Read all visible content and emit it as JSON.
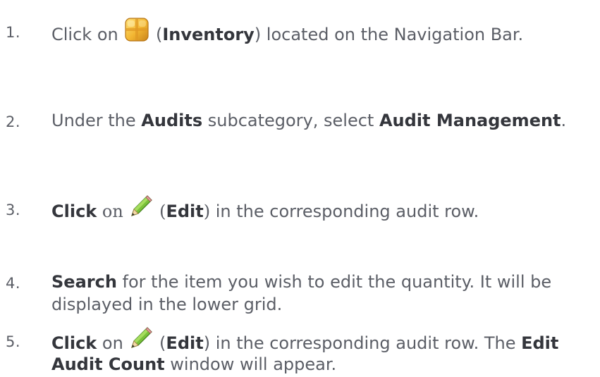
{
  "steps": [
    {
      "number": "1.",
      "pre": "Click on ",
      "icon": "inventory-box-icon",
      "open_paren": " (",
      "bold1": "Inventory",
      "post": ") located on the Navigation Bar."
    },
    {
      "number": "2.",
      "pre": "Under the ",
      "bold1": "Audits",
      "mid": " subcategory, select ",
      "bold2": "Audit Management",
      "post": "."
    },
    {
      "number": "3.",
      "bold1": "Click",
      "serif_on": " on ",
      "icon": "pencil-edit-icon",
      "serif_open": " (",
      "bold2": "Edit",
      "serif_close": ")",
      "post": " in the corresponding audit row."
    },
    {
      "number": "4.",
      "bold1": "Search",
      "line1_post": " for the item you wish to edit the quantity.  It will be",
      "line2": "displayed in the lower grid."
    },
    {
      "number": "5.",
      "bold1": "Click",
      "pre_icon": " on ",
      "icon": "pencil-edit-icon",
      "open_paren": " (",
      "bold2": "Edit",
      "line1_post": ") in the corresponding audit row.  The ",
      "bold3": "Edit",
      "line2_bold": "Audit Count",
      "line2_post": " window will appear."
    }
  ]
}
